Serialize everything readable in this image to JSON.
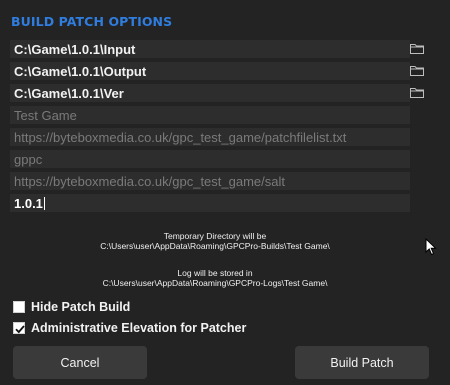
{
  "title": "BUILD PATCH OPTIONS",
  "paths": {
    "input": "C:\\Game\\1.0.1\\Input",
    "output": "C:\\Game\\1.0.1\\Output",
    "ver": "C:\\Game\\1.0.1\\Ver"
  },
  "fields": {
    "game_name": "Test Game",
    "patchfilelist_url": "https://byteboxmedia.co.uk/gpc_test_game/patchfilelist.txt",
    "extension": "gppc",
    "salt_url": "https://byteboxmedia.co.uk/gpc_test_game/salt",
    "version": "1.0.1"
  },
  "info": {
    "temp_label": "Temporary Directory will be",
    "temp_path": "C:\\Users\\user\\AppData\\Roaming\\GPCPro-Builds\\Test Game\\",
    "log_label": "Log will be stored in",
    "log_path": "C:\\Users\\user\\AppData\\Roaming\\GPCPro-Logs\\Test Game\\"
  },
  "options": {
    "hide_patch_build": {
      "label": "Hide Patch Build",
      "checked": false
    },
    "admin_elevation": {
      "label": "Administrative Elevation for Patcher",
      "checked": true
    }
  },
  "buttons": {
    "cancel": "Cancel",
    "build": "Build Patch"
  },
  "colors": {
    "accent": "#2f7dde",
    "background": "#232323",
    "field": "#2d2d2d",
    "button": "#3a3a3a"
  },
  "icons": {
    "browse": "folder-icon",
    "check": "checkmark-icon",
    "pointer": "mouse-cursor-icon"
  }
}
